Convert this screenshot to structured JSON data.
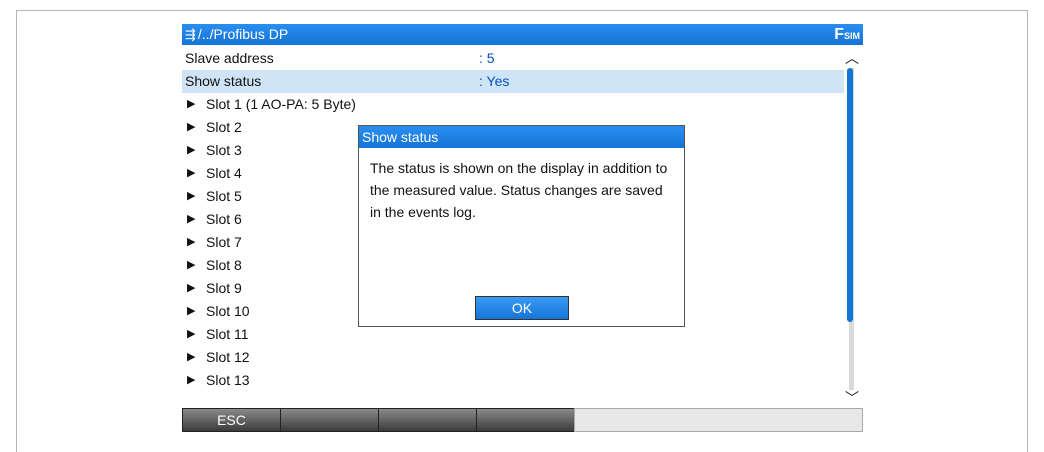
{
  "header": {
    "icon": "menu-nav-icon",
    "path": "/../Profibus DP",
    "flag": "F",
    "sim": "SIM"
  },
  "params": [
    {
      "label": "Slave address",
      "value": ": 5"
    },
    {
      "label": "Show status",
      "value": ": Yes"
    }
  ],
  "slots": [
    "Slot 1 (1 AO-PA: 5 Byte)",
    "Slot 2",
    "Slot 3",
    "Slot 4",
    "Slot 5",
    "Slot 6",
    "Slot 7",
    "Slot 8",
    "Slot 9",
    "Slot 10",
    "Slot 11",
    "Slot 12",
    "Slot 13"
  ],
  "dialog": {
    "title": "Show status",
    "text": "The status is shown on the display in addition to the measured value. Status changes are saved in the events log.",
    "ok_label": "OK"
  },
  "softkeys": {
    "esc_label": "ESC"
  },
  "colors": {
    "accent": "#1574d6",
    "selection": "#cfe4f6",
    "value_text": "#0050b8"
  }
}
